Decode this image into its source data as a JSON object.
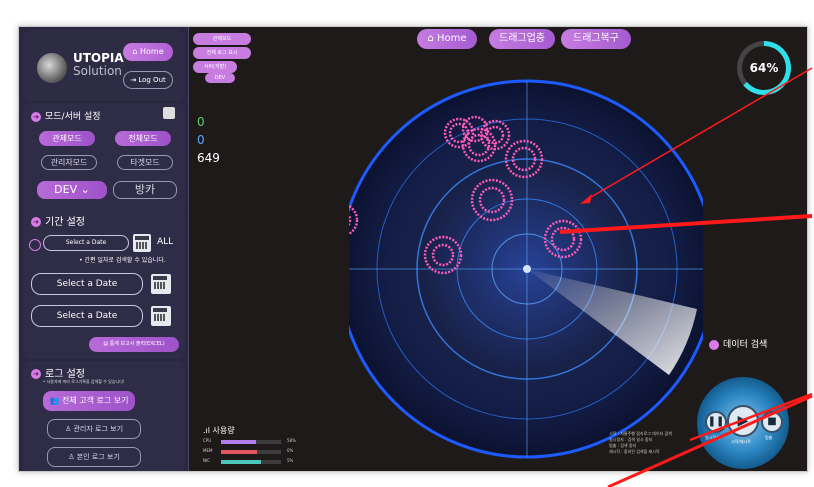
{
  "sidebar": {
    "logo_title": "UTOPIA",
    "logo_sub": "Solution",
    "home_label": "Home",
    "logout_label": "Log Out",
    "mode_section": "모드/서버 설정",
    "mode_buttons": [
      "관제모드",
      "전체모드",
      "관리자모드",
      "타겟모드"
    ],
    "server_value": "DEV",
    "server2_value": "방카",
    "period_section": "기간 설정",
    "select_date": "Select a Date",
    "all_label": "ALL",
    "hint": "• 간편 일자로 검색할 수 있습니다.",
    "date_from": "Select a Date",
    "date_to": "Select a Date",
    "export_label": "통계 보고서 출력(EXCEL)",
    "log_section": "로그 설정",
    "log_hint": "• 사용자에 따라 로그기록을 검색할 수 있습니다!",
    "log_buttons": [
      "전체 고객 로그 보기",
      "관리자 로그 보기",
      "본인 로그 보기"
    ]
  },
  "main": {
    "top_buttons": [
      "Home",
      "드래그업층",
      "드래그복구"
    ],
    "mini_menu": [
      "관제모드",
      "전체 로그 표시",
      "서버(개발)",
      "DEV"
    ],
    "gauge_label": "64%",
    "gauge_value": 0.64,
    "counters": [
      "0",
      "0",
      "649"
    ],
    "usage_title": "사용량",
    "usage_bars": [
      {
        "label": "CPU",
        "pct": "58%",
        "value": 0.58,
        "color": "#b07ee8"
      },
      {
        "label": "MEM",
        "pct": "0%",
        "value": 0.6,
        "color": "#e2565e"
      },
      {
        "label": "NIC",
        "pct": "5%",
        "value": 0.66,
        "color": "#4bc7b9"
      }
    ],
    "data_search_label": "데이터 검색",
    "notes": [
      "시작 : 자율주행 접속로그 데이터 검색",
      "일시정지 : 검색 일시 중지",
      "멈춤 : 검색 중지",
      "재시작 : 중지된 검색을 재시작"
    ],
    "player_labels": [
      "일시정지",
      "시작/재시작",
      "멈춤"
    ]
  },
  "colors": {
    "accent": "#c77ce0",
    "radar": "#1e6fff",
    "gauge": "#2fe0e8",
    "annotation": "#ff1a1a"
  }
}
